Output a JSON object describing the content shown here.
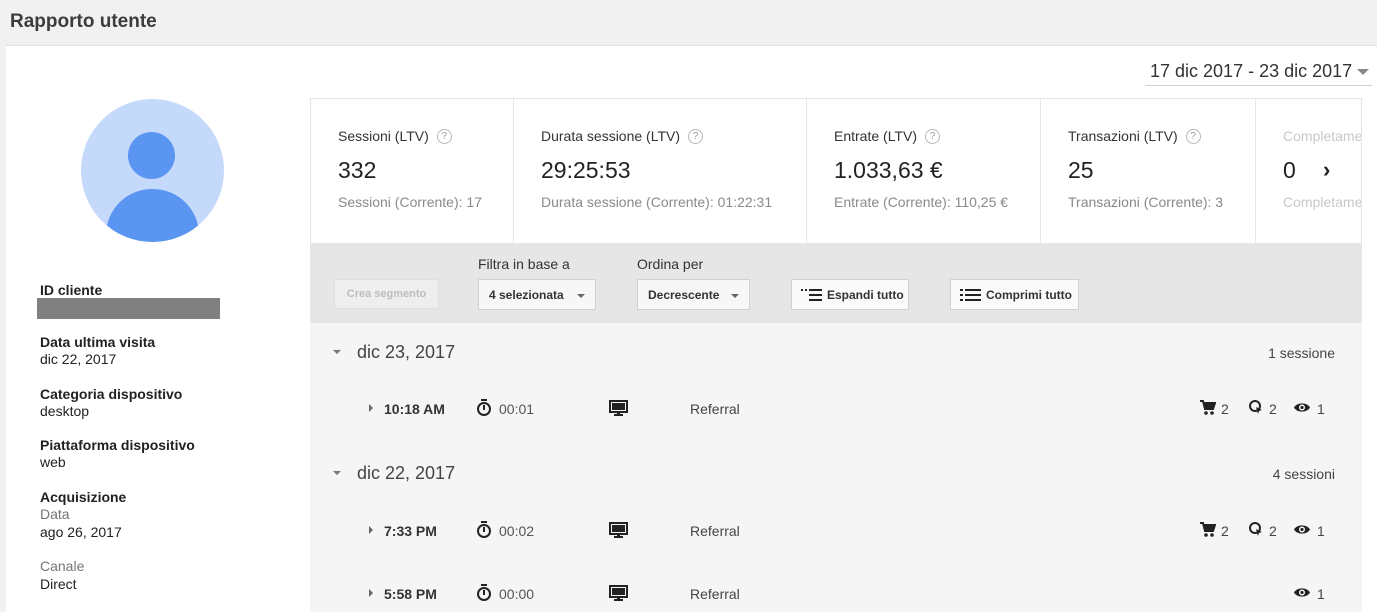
{
  "page_title": "Rapporto utente",
  "date_range": "17 dic 2017 - 23 dic 2017",
  "user": {
    "fields": [
      {
        "label": "ID cliente",
        "value": ""
      },
      {
        "label": "Data ultima visita",
        "value": "dic 22, 2017"
      },
      {
        "label": "Categoria dispositivo",
        "value": "desktop"
      },
      {
        "label": "Piattaforma dispositivo",
        "value": "web"
      }
    ],
    "acquisition": {
      "label": "Acquisizione",
      "date_label": "Data",
      "date_value": "ago 26, 2017",
      "channel_label": "Canale",
      "channel_value": "Direct"
    }
  },
  "metrics": [
    {
      "label": "Sessioni (LTV)",
      "value": "332",
      "current": "Sessioni (Corrente): 17"
    },
    {
      "label": "Durata sessione (LTV)",
      "value": "29:25:53",
      "current": "Durata sessione (Corrente): 01:22:31"
    },
    {
      "label": "Entrate (LTV)",
      "value": "1.033,63 €",
      "current": "Entrate (Corrente): 110,25 €"
    },
    {
      "label": "Transazioni (LTV)",
      "value": "25",
      "current": "Transazioni (Corrente): 3"
    },
    {
      "label": "Completame",
      "value": "0",
      "current": "Completame"
    }
  ],
  "toolbar": {
    "create_segment": "Crea segmento",
    "filter_label": "Filtra in base a",
    "filter_value": "4 selezionata",
    "sort_label": "Ordina per",
    "sort_value": "Decrescente",
    "expand_all": "Espandi tutto",
    "collapse_all": "Comprimi tutto"
  },
  "days": [
    {
      "date": "dic 23, 2017",
      "count": "1 sessione",
      "sessions": [
        {
          "time": "10:18 AM",
          "duration": "00:01",
          "source": "Referral",
          "cart": "2",
          "goal": "2",
          "views": "1"
        }
      ]
    },
    {
      "date": "dic 22, 2017",
      "count": "4 sessioni",
      "sessions": [
        {
          "time": "7:33 PM",
          "duration": "00:02",
          "source": "Referral",
          "cart": "2",
          "goal": "2",
          "views": "1"
        },
        {
          "time": "5:58 PM",
          "duration": "00:00",
          "source": "Referral",
          "views": "1"
        }
      ]
    }
  ]
}
